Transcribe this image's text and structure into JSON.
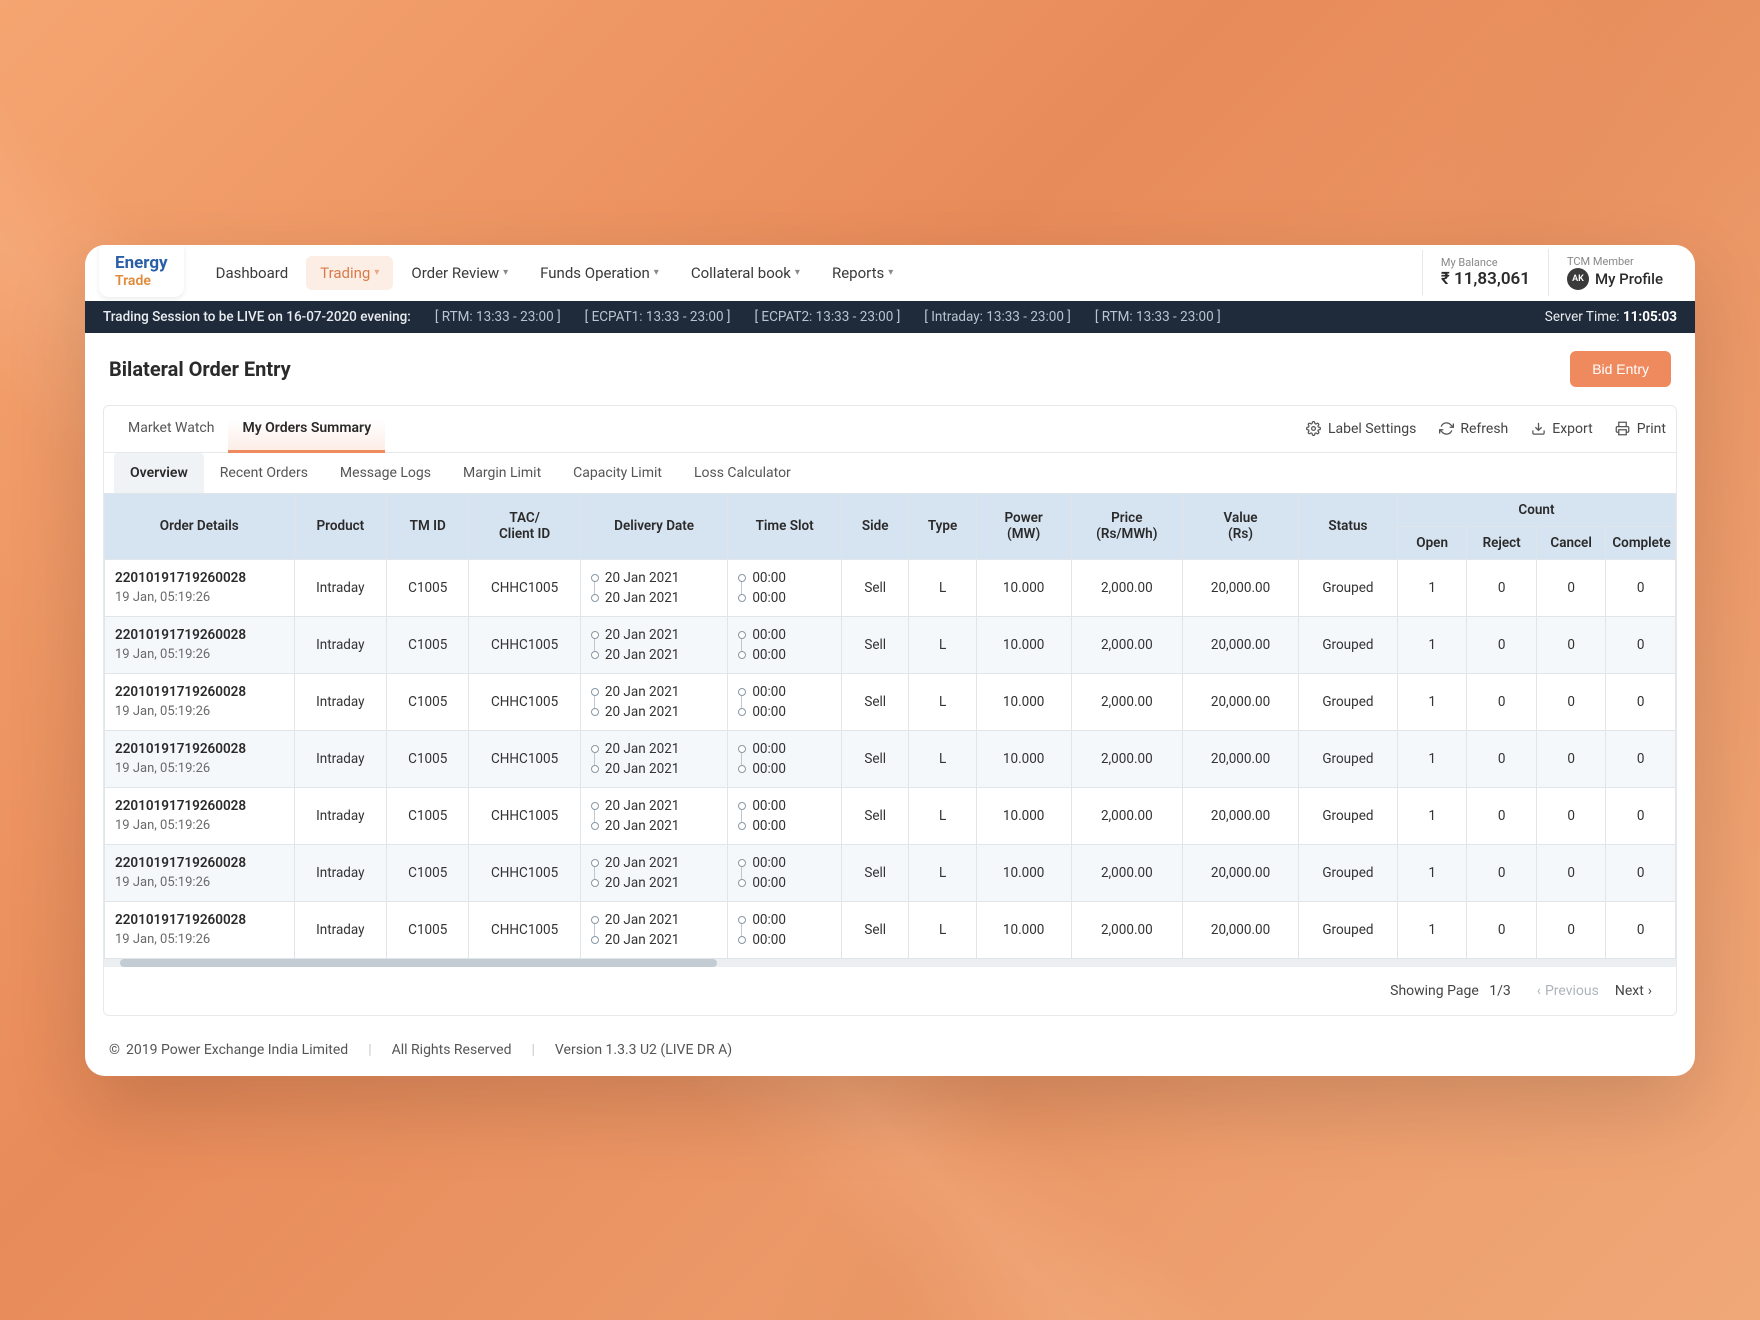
{
  "brand": {
    "line1": "Energy",
    "line2": "Trade"
  },
  "nav": {
    "dashboard": "Dashboard",
    "trading": "Trading",
    "order_review": "Order Review",
    "funds_op": "Funds Operation",
    "collateral": "Collateral book",
    "reports": "Reports"
  },
  "balance": {
    "label": "My Balance",
    "value": "₹ 11,83,061"
  },
  "profile": {
    "label": "TCM Member",
    "initials": "AK",
    "name": "My Profile"
  },
  "session": {
    "msg": "Trading Session to be LIVE on 16-07-2020 evening:",
    "slots": [
      "[ RTM:  13:33 - 23:00 ]",
      "[ ECPAT1:  13:33 - 23:00 ]",
      "[ ECPAT2:  13:33 - 23:00 ]",
      "[ Intraday:  13:33 - 23:00 ]",
      "[ RTM:  13:33 - 23:00 ]"
    ],
    "server_label": "Server Time:",
    "server_time": "11:05:03"
  },
  "page": {
    "title": "Bilateral Order Entry",
    "bid_btn": "Bid Entry"
  },
  "tabs1": {
    "market_watch": "Market Watch",
    "my_orders": "My Orders Summary"
  },
  "actions": {
    "label_settings": "Label Settings",
    "refresh": "Refresh",
    "export": "Export",
    "print": "Print"
  },
  "tabs2": {
    "overview": "Overview",
    "recent": "Recent Orders",
    "msglogs": "Message Logs",
    "margin": "Margin Limit",
    "capacity": "Capacity Limit",
    "loss": "Loss Calculator"
  },
  "headers": {
    "order_details": "Order Details",
    "product": "Product",
    "tmid": "TM ID",
    "tac1": "TAC/",
    "tac2": "Client ID",
    "delivery": "Delivery Date",
    "timeslot": "Time Slot",
    "side": "Side",
    "type": "Type",
    "power1": "Power",
    "power2": "(MW)",
    "price1": "Price",
    "price2": "(Rs/MWh)",
    "value1": "Value",
    "value2": "(Rs)",
    "status": "Status",
    "count": "Count",
    "open": "Open",
    "reject": "Reject",
    "cancel": "Cancel",
    "complete": "Complete"
  },
  "rows": [
    {
      "id": "22010191719260028",
      "ts": "19 Jan, 05:19:26",
      "product": "Intraday",
      "tmid": "C1005",
      "tac": "CHHC1005",
      "dd1": "20 Jan 2021",
      "dd2": "20 Jan 2021",
      "ts1": "00:00",
      "ts2": "00:00",
      "side": "Sell",
      "type": "L",
      "power": "10.000",
      "price": "2,000.00",
      "value": "20,000.00",
      "status": "Grouped",
      "open": "1",
      "reject": "0",
      "cancel": "0",
      "complete": "0"
    },
    {
      "id": "22010191719260028",
      "ts": "19 Jan, 05:19:26",
      "product": "Intraday",
      "tmid": "C1005",
      "tac": "CHHC1005",
      "dd1": "20 Jan 2021",
      "dd2": "20 Jan 2021",
      "ts1": "00:00",
      "ts2": "00:00",
      "side": "Sell",
      "type": "L",
      "power": "10.000",
      "price": "2,000.00",
      "value": "20,000.00",
      "status": "Grouped",
      "open": "1",
      "reject": "0",
      "cancel": "0",
      "complete": "0"
    },
    {
      "id": "22010191719260028",
      "ts": "19 Jan, 05:19:26",
      "product": "Intraday",
      "tmid": "C1005",
      "tac": "CHHC1005",
      "dd1": "20 Jan 2021",
      "dd2": "20 Jan 2021",
      "ts1": "00:00",
      "ts2": "00:00",
      "side": "Sell",
      "type": "L",
      "power": "10.000",
      "price": "2,000.00",
      "value": "20,000.00",
      "status": "Grouped",
      "open": "1",
      "reject": "0",
      "cancel": "0",
      "complete": "0"
    },
    {
      "id": "22010191719260028",
      "ts": "19 Jan, 05:19:26",
      "product": "Intraday",
      "tmid": "C1005",
      "tac": "CHHC1005",
      "dd1": "20 Jan 2021",
      "dd2": "20 Jan 2021",
      "ts1": "00:00",
      "ts2": "00:00",
      "side": "Sell",
      "type": "L",
      "power": "10.000",
      "price": "2,000.00",
      "value": "20,000.00",
      "status": "Grouped",
      "open": "1",
      "reject": "0",
      "cancel": "0",
      "complete": "0"
    },
    {
      "id": "22010191719260028",
      "ts": "19 Jan, 05:19:26",
      "product": "Intraday",
      "tmid": "C1005",
      "tac": "CHHC1005",
      "dd1": "20 Jan 2021",
      "dd2": "20 Jan 2021",
      "ts1": "00:00",
      "ts2": "00:00",
      "side": "Sell",
      "type": "L",
      "power": "10.000",
      "price": "2,000.00",
      "value": "20,000.00",
      "status": "Grouped",
      "open": "1",
      "reject": "0",
      "cancel": "0",
      "complete": "0"
    },
    {
      "id": "22010191719260028",
      "ts": "19 Jan, 05:19:26",
      "product": "Intraday",
      "tmid": "C1005",
      "tac": "CHHC1005",
      "dd1": "20 Jan 2021",
      "dd2": "20 Jan 2021",
      "ts1": "00:00",
      "ts2": "00:00",
      "side": "Sell",
      "type": "L",
      "power": "10.000",
      "price": "2,000.00",
      "value": "20,000.00",
      "status": "Grouped",
      "open": "1",
      "reject": "0",
      "cancel": "0",
      "complete": "0"
    },
    {
      "id": "22010191719260028",
      "ts": "19 Jan, 05:19:26",
      "product": "Intraday",
      "tmid": "C1005",
      "tac": "CHHC1005",
      "dd1": "20 Jan 2021",
      "dd2": "20 Jan 2021",
      "ts1": "00:00",
      "ts2": "00:00",
      "side": "Sell",
      "type": "L",
      "power": "10.000",
      "price": "2,000.00",
      "value": "20,000.00",
      "status": "Grouped",
      "open": "1",
      "reject": "0",
      "cancel": "0",
      "complete": "0"
    }
  ],
  "paging": {
    "showing": "Showing Page",
    "page": "1/3",
    "prev": "Previous",
    "next": "Next"
  },
  "footer": {
    "copyright": "2019 Power Exchange India Limited",
    "rights": "All Rights Reserved",
    "version": "Version 1.3.3 U2 (LIVE DR A)"
  }
}
